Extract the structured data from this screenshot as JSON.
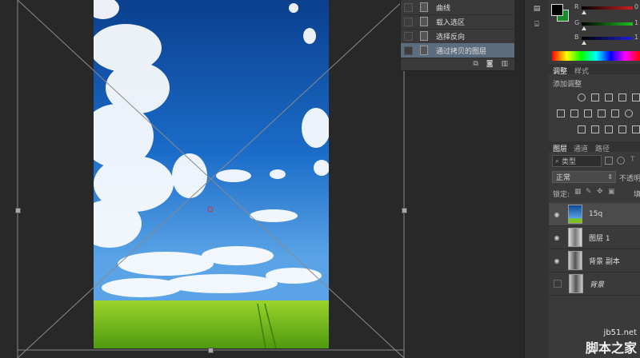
{
  "history": {
    "items": [
      {
        "label": "曲线",
        "active": false
      },
      {
        "label": "载入选区",
        "active": false
      },
      {
        "label": "选择反向",
        "active": false
      },
      {
        "label": "通过拷贝的图层",
        "active": true
      }
    ],
    "footer_icons": [
      "new-snapshot-icon",
      "camera-icon",
      "trash-icon"
    ]
  },
  "color": {
    "fg": "#000000",
    "bg": "#1a8a2a",
    "channels": [
      {
        "label": "R",
        "value": "0",
        "color": "#d02020"
      },
      {
        "label": "G",
        "value": "1",
        "color": "#20a020"
      },
      {
        "label": "B",
        "value": "1",
        "color": "#2020d0"
      }
    ]
  },
  "adjustments": {
    "tabs": [
      "调整",
      "样式"
    ],
    "add_label": "添加调整"
  },
  "layers_panel": {
    "tabs": [
      "图层",
      "通道",
      "路径"
    ],
    "kind_filter": "类型",
    "blend_mode": "正常",
    "opacity_label": "不透明",
    "lock_label": "锁定:",
    "fill_label": "填",
    "layers": [
      {
        "name": "15q",
        "visible": true,
        "active": true,
        "italic": false
      },
      {
        "name": "图层 1",
        "visible": true,
        "active": false,
        "italic": false
      },
      {
        "name": "背景 副本",
        "visible": true,
        "active": false,
        "italic": false
      },
      {
        "name": "背景",
        "visible": false,
        "active": false,
        "italic": true
      }
    ]
  },
  "watermark": {
    "site": "jb51.net",
    "name": "脚本之家"
  },
  "colors": {
    "active_row": "#5d6d80",
    "sky_top": "#0d4a9a",
    "grass": "#7cc21a"
  }
}
